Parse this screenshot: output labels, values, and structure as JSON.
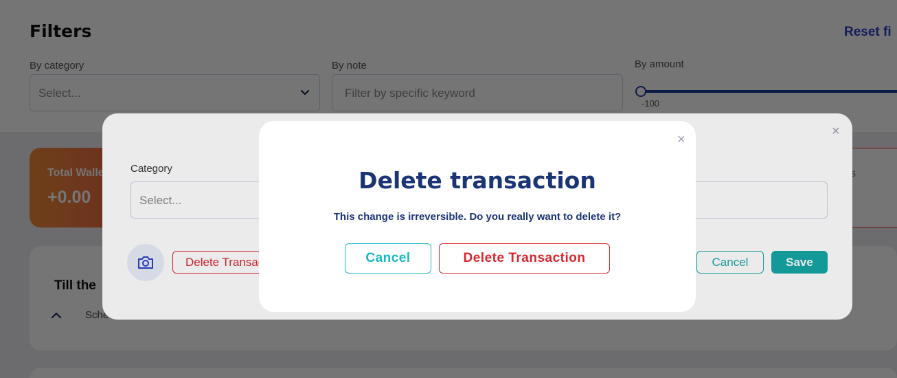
{
  "filters": {
    "title": "Filters",
    "reset_label": "Reset fi",
    "category": {
      "label": "By category",
      "placeholder": "Select..."
    },
    "note": {
      "label": "By note",
      "placeholder": "Filter by specific keyword"
    },
    "amount": {
      "label": "By amount",
      "min_label": "-100"
    }
  },
  "wallet": {
    "label": "Total Walle",
    "value": "+0.00"
  },
  "right_card": {
    "text": "s"
  },
  "section": {
    "title": "Till the",
    "subtitle": "Sche"
  },
  "edit_dialog": {
    "close_glyph": "×",
    "category_label": "Category",
    "category_placeholder": "Select...",
    "delete_label": "Delete Transaction",
    "cancel_label": "Cancel",
    "save_label": "Save"
  },
  "confirm_dialog": {
    "close_glyph": "×",
    "title": "Delete transaction",
    "message": "This change is irreversible. Do you really want to delete it?",
    "cancel_label": "Cancel",
    "delete_label": "Delete Transaction"
  },
  "colors": {
    "title_navy": "#1a3475",
    "danger": "#d9262e",
    "teal": "#16a6a6",
    "accent_cyan": "#18b9c4",
    "link_blue": "#2b3fc9",
    "wallet_orange": "#f08a3a"
  }
}
